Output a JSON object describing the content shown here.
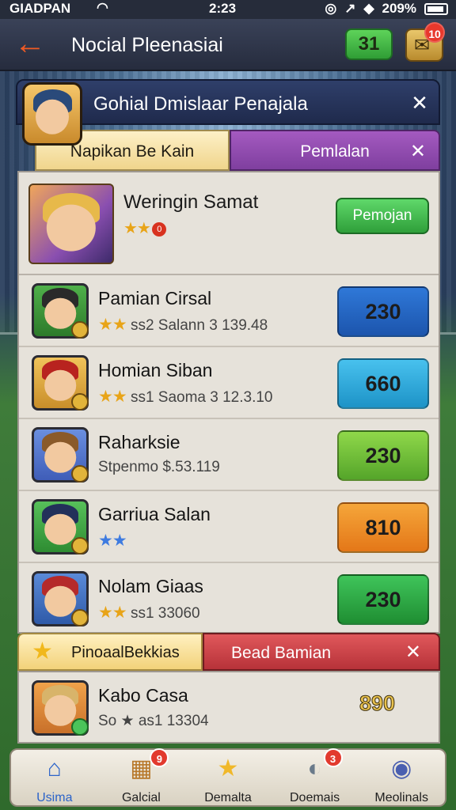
{
  "status_bar": {
    "carrier": "GIADPAN",
    "time": "2:23",
    "battery": "209%"
  },
  "header": {
    "title": "Nocial Pleenasiai",
    "coins": "31",
    "notifications": "10"
  },
  "panel": {
    "title": "Gohial Dmislaar Penajala",
    "tabs": [
      {
        "label": "Napikan Be Kain"
      },
      {
        "label": "Pemlalan"
      }
    ]
  },
  "featured": {
    "name": "Weringin Samat",
    "stars": "★★",
    "badge": "0",
    "button_label": "Pemojan"
  },
  "players": [
    {
      "name": "Pamian Cirsal",
      "stars": "★★",
      "meta": "ss2 Salann 3 139.48",
      "score": "230",
      "color": "#2f78d8",
      "color2": "#1c55ad"
    },
    {
      "name": "Homian Siban",
      "stars": "★★",
      "meta": "ss1 Saoma 3 12.3.10",
      "score": "660",
      "color": "#48c1ee",
      "color2": "#1d93c7"
    },
    {
      "name": "Raharksie",
      "stars": "",
      "meta": "Stpenmo $.53.119",
      "score": "230",
      "color": "#8fd84a",
      "color2": "#55a52a"
    },
    {
      "name": "Garriua Salan",
      "stars": "★★",
      "meta": "",
      "score": "810",
      "color": "#f5a63a",
      "color2": "#e47718"
    },
    {
      "name": "Nolam Giaas",
      "stars": "★★",
      "meta": "ss1 33060",
      "score": "230",
      "color": "#3fc45a",
      "color2": "#1f8e32"
    }
  ],
  "section2": {
    "left_tab": "PinoaalBekkias",
    "right_tab": "Bead Bamian",
    "player": {
      "name": "Kabo Casa",
      "meta": "So ★ as1 13304",
      "score": "890"
    }
  },
  "bottom_nav": [
    {
      "label": "Usima",
      "icon": "home-icon"
    },
    {
      "label": "Galcial",
      "icon": "crate-icon",
      "badge": "9"
    },
    {
      "label": "Demalta",
      "icon": "star-badge-icon"
    },
    {
      "label": "Doemais",
      "icon": "ball-icon",
      "badge": "3"
    },
    {
      "label": "Meolinals",
      "icon": "medal-icon"
    }
  ]
}
